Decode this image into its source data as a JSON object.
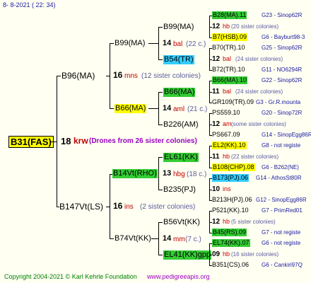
{
  "date": "8-  8-2021 ( 22: 34)",
  "footer": {
    "copyright": "Copyright 2004-2021 © Karl Kehrle Foundation",
    "site": "www.pedigreeapis.org"
  },
  "root": {
    "id": "B31(FAS)",
    "num": "18",
    "loc": "krw",
    "note": "(Drones from 26 sister colonies)"
  },
  "gen1": [
    {
      "id": "B96(MA)",
      "num": "16",
      "loc": "mns",
      "note": "(12 sister colonies)"
    },
    {
      "id": "B147Vt(LS)",
      "num": "16",
      "loc": "ins",
      "note": "(2 sister colonies)"
    }
  ],
  "gen2": [
    {
      "id": "B99(MA)",
      "num": "14",
      "loc": "bal",
      "note": "(22 c.)"
    },
    {
      "id": "B66(MA)",
      "num": "14",
      "loc": "aml",
      "note": "(21 c.)"
    },
    {
      "id": "B14Vt(RHO)",
      "num": "13",
      "loc": "hbg",
      "note": "(18 c.)"
    },
    {
      "id": "B74Vt(KK)",
      "num": "14",
      "loc": "mm",
      "note": "(7 c.)"
    }
  ],
  "gen3": [
    {
      "id": "B99(MA)",
      "num": "",
      "loc": "",
      "note": ""
    },
    {
      "id": "B54(TR)",
      "num": "",
      "loc": "",
      "note": ""
    },
    {
      "id": "B66(MA)",
      "num": "",
      "loc": "",
      "note": ""
    },
    {
      "id": "B226(AM)",
      "num": "",
      "loc": "",
      "note": ""
    },
    {
      "id": "EL61(KK)",
      "num": "",
      "loc": "",
      "note": ""
    },
    {
      "id": "B235(PJ)",
      "num": "",
      "loc": "",
      "note": ""
    },
    {
      "id": "B56Vt(KK)",
      "num": "",
      "loc": "",
      "note": ""
    },
    {
      "id": "EL41(KK)gpp",
      "num": "",
      "loc": "",
      "note": ""
    }
  ],
  "gen4": [
    {
      "id": "B28(MA).11",
      "code": "G23 - Sinop62R"
    },
    {
      "num": "12",
      "loc": "hb",
      "note": "(20 sister colonies)"
    },
    {
      "id": "B7(HSB).09",
      "code": "G6 - Bayburt98-3"
    },
    {
      "id": "B70(TR).10",
      "code": "G25 - Sinop62R"
    },
    {
      "num": "12",
      "loc": "bal",
      "note": "(24 sister colonies)"
    },
    {
      "id": "B72(TR).10",
      "code": "G11 - NO6294R"
    },
    {
      "id": "B66(MA).10",
      "code": "G22 - Sinop62R"
    },
    {
      "num": "11",
      "loc": "bal",
      "note": "(24 sister colonies)"
    },
    {
      "id": "GR109(TR).09",
      "code": "G3 - Gr.R.mounta"
    },
    {
      "id": "PS559.10",
      "code": "G20 - Sinop72R"
    },
    {
      "num": "12",
      "loc": "am",
      "note": "(some sister colonies)"
    },
    {
      "id": "PS667.09",
      "code": "G14 - SinopEgg86R"
    },
    {
      "id": "EL2(KK).10",
      "code": "G8 - not registe"
    },
    {
      "num": "11",
      "loc": "hb",
      "note": "(22 sister colonies)"
    },
    {
      "id": "B108(CHP).08",
      "code": "G6 - B262(NE)"
    },
    {
      "id": "B173(PJ).06",
      "code": "G14 - AthosSt80R"
    },
    {
      "num": "10",
      "loc": "ins",
      "note": ""
    },
    {
      "id": "B213H(PJ).06",
      "code": "G12 - SinopEgg86R"
    },
    {
      "id": "P521(KK).10",
      "code": "G7 - PrimRed01"
    },
    {
      "num": "12",
      "loc": "hb",
      "note": "(5 sister colonies)"
    },
    {
      "id": "B45(RS).09",
      "code": "G7 - not registe"
    },
    {
      "id": "EL74(KK).07",
      "code": "G6 - not registe"
    },
    {
      "num": "09",
      "loc": "hb",
      "note": "(16 sister colonies)"
    },
    {
      "id": "B351(CS).06",
      "code": "G6 - Cankiri97Q"
    }
  ]
}
